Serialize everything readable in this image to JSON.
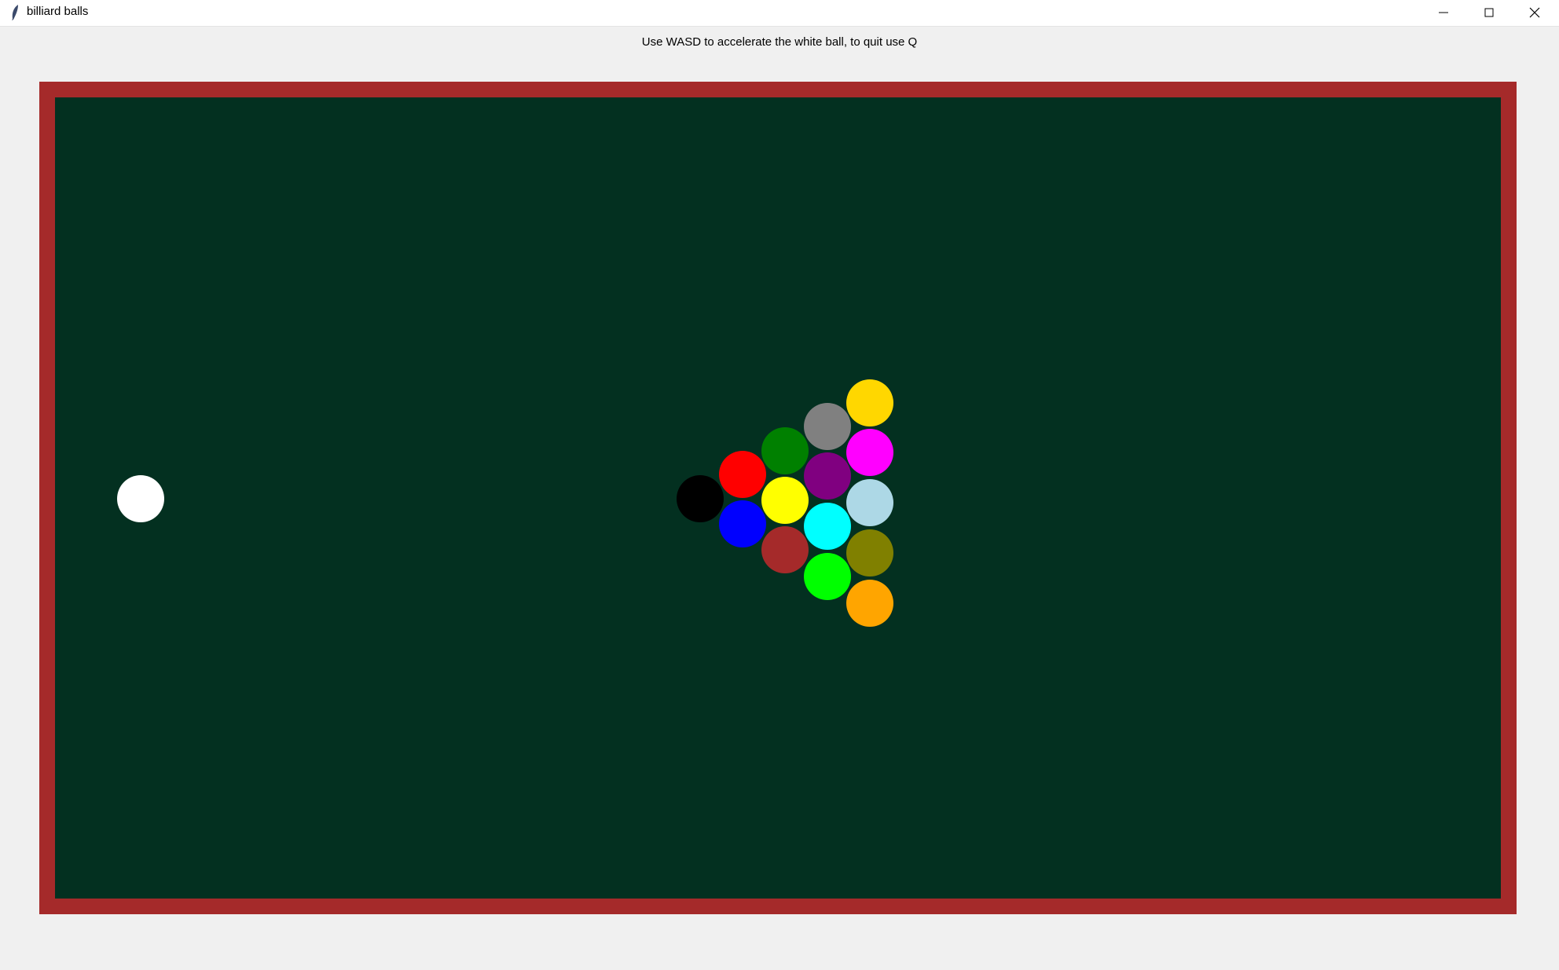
{
  "window": {
    "title": "billiard balls"
  },
  "instructions": "Use WASD to accelerate the white ball, to quit use Q",
  "table": {
    "rail_color": "#a52a2a",
    "felt_color": "#033020"
  },
  "balls": [
    {
      "name": "white",
      "color": "#ffffff"
    },
    {
      "name": "black",
      "color": "#000000"
    },
    {
      "name": "red",
      "color": "#ff0000"
    },
    {
      "name": "blue",
      "color": "#0000ff"
    },
    {
      "name": "green",
      "color": "#008000"
    },
    {
      "name": "yellow",
      "color": "#ffff00"
    },
    {
      "name": "brown",
      "color": "#a52a2a"
    },
    {
      "name": "gray",
      "color": "#808080"
    },
    {
      "name": "purple",
      "color": "#800080"
    },
    {
      "name": "cyan",
      "color": "#00ffff"
    },
    {
      "name": "lime",
      "color": "#00ff00"
    },
    {
      "name": "gold",
      "color": "#ffd700"
    },
    {
      "name": "magenta",
      "color": "#ff00ff"
    },
    {
      "name": "lightblue",
      "color": "#add8e6"
    },
    {
      "name": "olive",
      "color": "#808000"
    },
    {
      "name": "orange",
      "color": "#ffa500"
    }
  ]
}
